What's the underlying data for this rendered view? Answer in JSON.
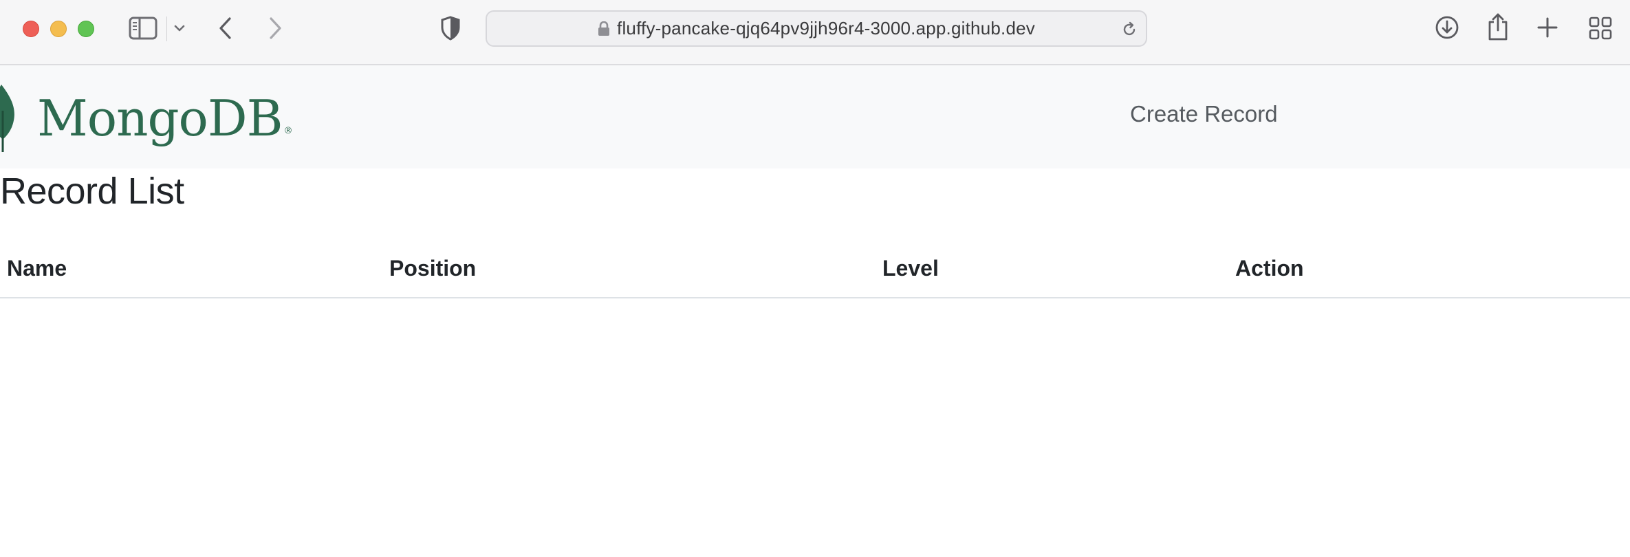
{
  "browser": {
    "url": "fluffy-pancake-qjq64pv9jjh96r4-3000.app.github.dev",
    "icons": {
      "sidebar": "sidebar-icon",
      "chevron": "chevron-down-icon",
      "back": "back-arrow-icon",
      "forward": "forward-arrow-icon",
      "privacy": "shield-icon",
      "lock": "lock-icon",
      "reload": "reload-icon",
      "download": "download-icon",
      "share": "share-icon",
      "new_tab": "plus-icon",
      "tab_overview": "grid-icon"
    }
  },
  "navbar": {
    "logo_text": "MongoDB",
    "logo_mark": "®",
    "create_link": "Create Record"
  },
  "page": {
    "title": "Record List",
    "table": {
      "columns": [
        "Name",
        "Position",
        "Level",
        "Action"
      ],
      "rows": []
    }
  },
  "colors": {
    "brand_green": "#2d6a4f",
    "navbar_bg": "#f8f9fa",
    "text": "#212529"
  }
}
